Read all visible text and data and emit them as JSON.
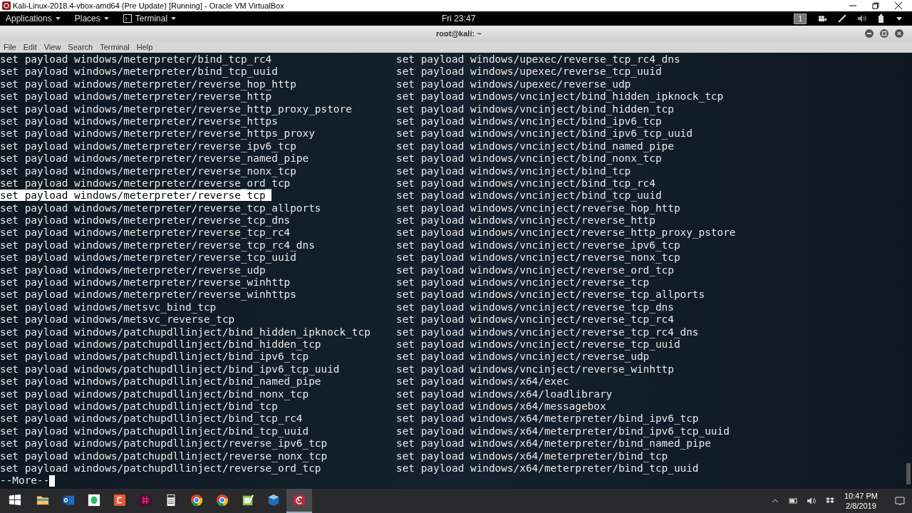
{
  "host_window": {
    "title": "Kali-Linux-2018.4-vbox-amd64 (Pre Update) [Running] - Oracle VM VirtualBox"
  },
  "top_panel": {
    "menus": [
      "Applications",
      "Places",
      "Terminal"
    ],
    "clock": "Fri 23:47",
    "workspace": "1"
  },
  "terminal": {
    "title": "root@kali: ~",
    "menu": [
      "File",
      "Edit",
      "View",
      "Search",
      "Terminal",
      "Help"
    ],
    "lines": [
      {
        "left": "set payload windows/meterpreter/bind_tcp_rc4",
        "right": "set payload windows/upexec/reverse_tcp_rc4_dns",
        "selected": false
      },
      {
        "left": "set payload windows/meterpreter/bind_tcp_uuid",
        "right": "set payload windows/upexec/reverse_tcp_uuid",
        "selected": false
      },
      {
        "left": "set payload windows/meterpreter/reverse_hop_http",
        "right": "set payload windows/upexec/reverse_udp",
        "selected": false
      },
      {
        "left": "set payload windows/meterpreter/reverse_http",
        "right": "set payload windows/vncinject/bind_hidden_ipknock_tcp",
        "selected": false
      },
      {
        "left": "set payload windows/meterpreter/reverse_http_proxy_pstore",
        "right": "set payload windows/vncinject/bind_hidden_tcp",
        "selected": false
      },
      {
        "left": "set payload windows/meterpreter/reverse_https",
        "right": "set payload windows/vncinject/bind_ipv6_tcp",
        "selected": false
      },
      {
        "left": "set payload windows/meterpreter/reverse_https_proxy",
        "right": "set payload windows/vncinject/bind_ipv6_tcp_uuid",
        "selected": false
      },
      {
        "left": "set payload windows/meterpreter/reverse_ipv6_tcp",
        "right": "set payload windows/vncinject/bind_named_pipe",
        "selected": false
      },
      {
        "left": "set payload windows/meterpreter/reverse_named_pipe",
        "right": "set payload windows/vncinject/bind_nonx_tcp",
        "selected": false
      },
      {
        "left": "set payload windows/meterpreter/reverse_nonx_tcp",
        "right": "set payload windows/vncinject/bind_tcp",
        "selected": false
      },
      {
        "left": "set payload windows/meterpreter/reverse_ord_tcp",
        "right": "set payload windows/vncinject/bind_tcp_rc4",
        "selected": false
      },
      {
        "left": "set payload windows/meterpreter/reverse_tcp",
        "right": "set payload windows/vncinject/bind_tcp_uuid",
        "selected": true
      },
      {
        "left": "set payload windows/meterpreter/reverse_tcp_allports",
        "right": "set payload windows/vncinject/reverse_hop_http",
        "selected": false
      },
      {
        "left": "set payload windows/meterpreter/reverse_tcp_dns",
        "right": "set payload windows/vncinject/reverse_http",
        "selected": false
      },
      {
        "left": "set payload windows/meterpreter/reverse_tcp_rc4",
        "right": "set payload windows/vncinject/reverse_http_proxy_pstore",
        "selected": false
      },
      {
        "left": "set payload windows/meterpreter/reverse_tcp_rc4_dns",
        "right": "set payload windows/vncinject/reverse_ipv6_tcp",
        "selected": false
      },
      {
        "left": "set payload windows/meterpreter/reverse_tcp_uuid",
        "right": "set payload windows/vncinject/reverse_nonx_tcp",
        "selected": false
      },
      {
        "left": "set payload windows/meterpreter/reverse_udp",
        "right": "set payload windows/vncinject/reverse_ord_tcp",
        "selected": false
      },
      {
        "left": "set payload windows/meterpreter/reverse_winhttp",
        "right": "set payload windows/vncinject/reverse_tcp",
        "selected": false
      },
      {
        "left": "set payload windows/meterpreter/reverse_winhttps",
        "right": "set payload windows/vncinject/reverse_tcp_allports",
        "selected": false
      },
      {
        "left": "set payload windows/metsvc_bind_tcp",
        "right": "set payload windows/vncinject/reverse_tcp_dns",
        "selected": false
      },
      {
        "left": "set payload windows/metsvc_reverse_tcp",
        "right": "set payload windows/vncinject/reverse_tcp_rc4",
        "selected": false
      },
      {
        "left": "set payload windows/patchupdllinject/bind_hidden_ipknock_tcp",
        "right": "set payload windows/vncinject/reverse_tcp_rc4_dns",
        "selected": false
      },
      {
        "left": "set payload windows/patchupdllinject/bind_hidden_tcp",
        "right": "set payload windows/vncinject/reverse_tcp_uuid",
        "selected": false
      },
      {
        "left": "set payload windows/patchupdllinject/bind_ipv6_tcp",
        "right": "set payload windows/vncinject/reverse_udp",
        "selected": false
      },
      {
        "left": "set payload windows/patchupdllinject/bind_ipv6_tcp_uuid",
        "right": "set payload windows/vncinject/reverse_winhttp",
        "selected": false
      },
      {
        "left": "set payload windows/patchupdllinject/bind_named_pipe",
        "right": "set payload windows/x64/exec",
        "selected": false
      },
      {
        "left": "set payload windows/patchupdllinject/bind_nonx_tcp",
        "right": "set payload windows/x64/loadlibrary",
        "selected": false
      },
      {
        "left": "set payload windows/patchupdllinject/bind_tcp",
        "right": "set payload windows/x64/messagebox",
        "selected": false
      },
      {
        "left": "set payload windows/patchupdllinject/bind_tcp_rc4",
        "right": "set payload windows/x64/meterpreter/bind_ipv6_tcp",
        "selected": false
      },
      {
        "left": "set payload windows/patchupdllinject/bind_tcp_uuid",
        "right": "set payload windows/x64/meterpreter/bind_ipv6_tcp_uuid",
        "selected": false
      },
      {
        "left": "set payload windows/patchupdllinject/reverse_ipv6_tcp",
        "right": "set payload windows/x64/meterpreter/bind_named_pipe",
        "selected": false
      },
      {
        "left": "set payload windows/patchupdllinject/reverse_nonx_tcp",
        "right": "set payload windows/x64/meterpreter/bind_tcp",
        "selected": false
      },
      {
        "left": "set payload windows/patchupdllinject/reverse_ord_tcp",
        "right": "set payload windows/x64/meterpreter/bind_tcp_uuid",
        "selected": false
      }
    ],
    "pager": "--More--"
  },
  "taskbar": {
    "apps": [
      {
        "kind": "start",
        "selected": false
      },
      {
        "kind": "folder",
        "selected": false
      },
      {
        "kind": "mail",
        "selected": false
      },
      {
        "kind": "note",
        "selected": false
      },
      {
        "kind": "code",
        "selected": false
      },
      {
        "kind": "chat",
        "selected": false
      },
      {
        "kind": "calculator",
        "selected": false
      },
      {
        "kind": "browser",
        "selected": false
      },
      {
        "kind": "browser",
        "selected": false
      },
      {
        "kind": "editor",
        "selected": false
      },
      {
        "kind": "cube",
        "selected": false
      },
      {
        "kind": "vm",
        "selected": true
      }
    ],
    "time": "10:47 PM",
    "date": "2/8/2019"
  }
}
